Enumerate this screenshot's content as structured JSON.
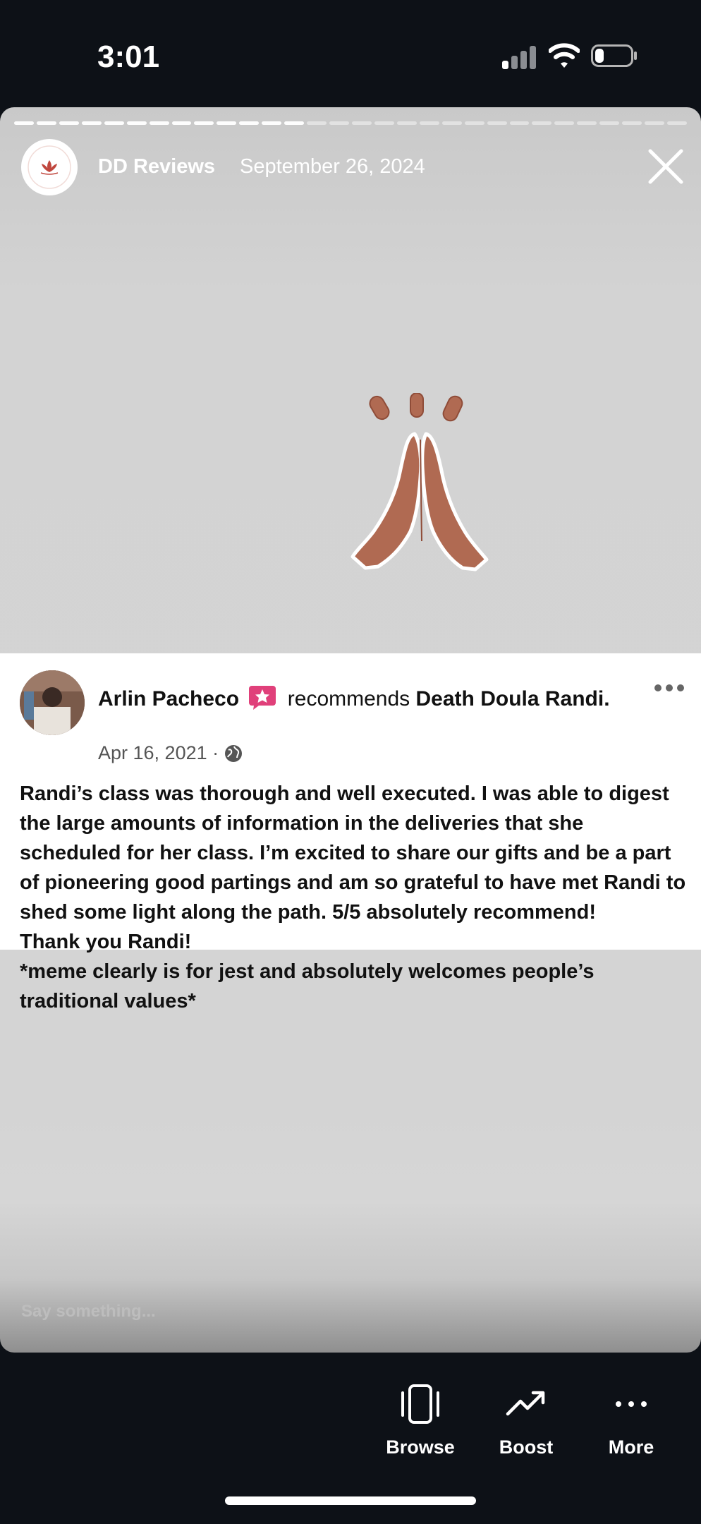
{
  "status_bar": {
    "time": "3:01",
    "battery_level": 0.25
  },
  "story": {
    "account_name": "DD Reviews",
    "date": "September 26, 2024",
    "progress_segments_total": 30,
    "progress_segments_viewed": 13,
    "reply_placeholder": "Say something..."
  },
  "review_card": {
    "reviewer": "Arlin Pacheco",
    "verb": "recommends",
    "page_name": "Death Doula Randi.",
    "date": "Apr 16, 2021 ·",
    "text": [
      "Randi’s class was thorough and well executed. I was able to digest the large amounts of information in the deliveries that she scheduled for her class. I’m excited to share our gifts and be a part of pioneering good partings and am so grateful to have met Randi to shed some light along the path. 5/5 absolutely recommend!",
      "Thank you Randi!",
      "*meme clearly is for jest and absolutely welcomes people’s traditional values*"
    ]
  },
  "actions": [
    {
      "label": "Browse",
      "icon": "browse-icon"
    },
    {
      "label": "Boost",
      "icon": "boost-icon"
    },
    {
      "label": "More",
      "icon": "more-icon"
    }
  ],
  "colors": {
    "accent_star": "#e0407a",
    "hands": "#b06a52",
    "background": "#0d1117"
  }
}
